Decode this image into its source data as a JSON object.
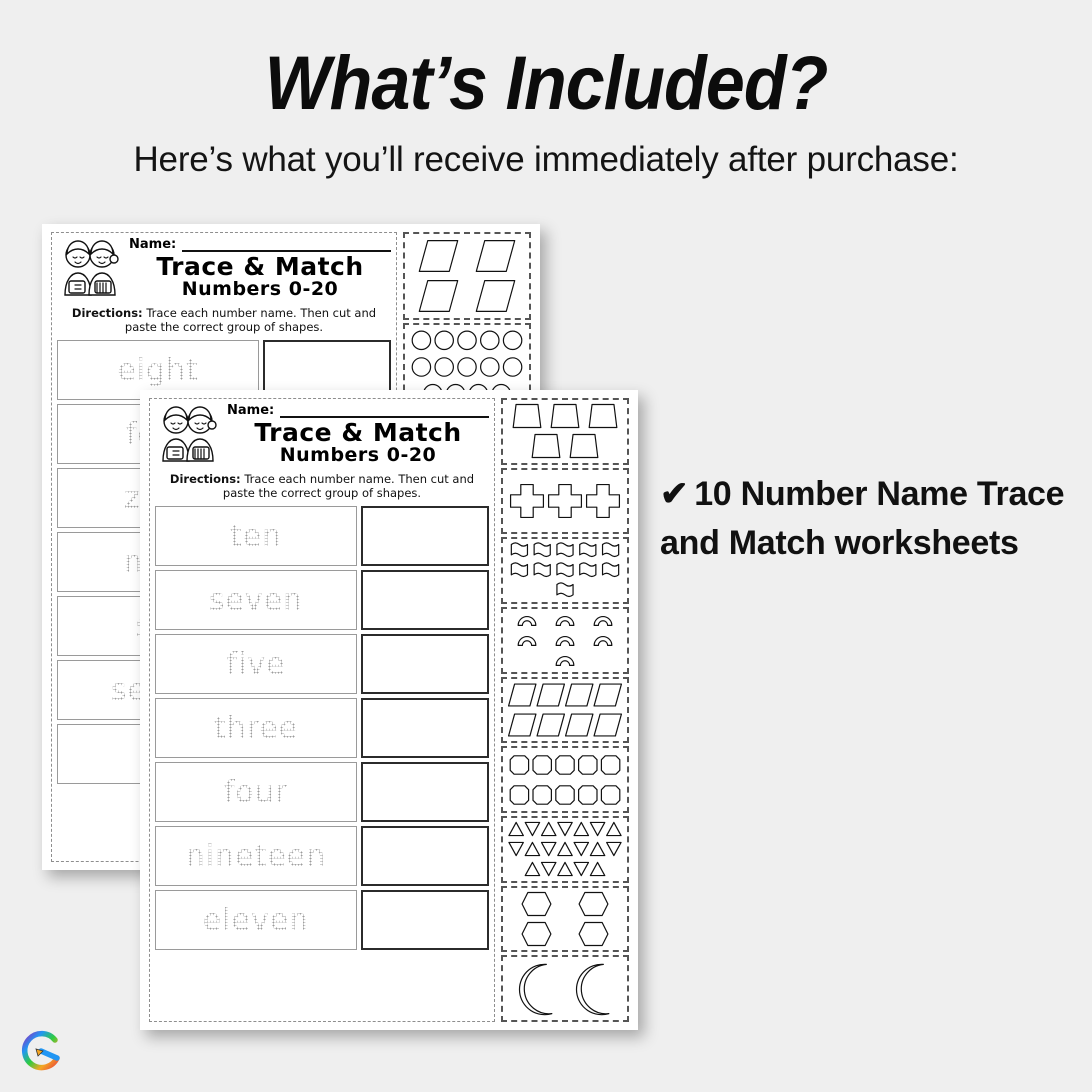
{
  "header": {
    "title": "What’s Included?",
    "subtitle": "Here’s what you’ll receive immediately after purchase:"
  },
  "bullet": {
    "check_icon": "✔",
    "text": "10 Number Name Trace and Match worksheets"
  },
  "colors": {
    "background": "#efefef",
    "text": "#111111",
    "paper": "#ffffff",
    "trace_gray": "#bdbdbd",
    "dash_gray": "#555555"
  },
  "worksheet_back": {
    "name_label": "Name:",
    "title": "Trace & Match",
    "subtitle": "Numbers 0-20",
    "directions_label": "Directions:",
    "directions": "Trace each number name. Then cut and paste the correct group of shapes.",
    "words": [
      "eight",
      "four",
      "zero",
      "nine",
      "six",
      "seven",
      ""
    ],
    "shape_groups": [
      {
        "shape": "parallelogram",
        "count": 4
      },
      {
        "shape": "circle",
        "count": 14
      }
    ]
  },
  "worksheet_front": {
    "name_label": "Name:",
    "title": "Trace & Match",
    "subtitle": "Numbers 0-20",
    "directions_label": "Directions:",
    "directions": "Trace each number name. Then cut and paste the correct group of shapes.",
    "words": [
      "ten",
      "seven",
      "five",
      "three",
      "four",
      "nineteen",
      "eleven"
    ],
    "shape_groups": [
      {
        "shape": "trapezoid",
        "count": 5
      },
      {
        "shape": "cross",
        "count": 3
      },
      {
        "shape": "flag",
        "count": 11
      },
      {
        "shape": "arch",
        "count": 7
      },
      {
        "shape": "parallelogram",
        "count": 8
      },
      {
        "shape": "octagon",
        "count": 10
      },
      {
        "shape": "triangle",
        "count": 19
      },
      {
        "shape": "hexagon",
        "count": 4
      },
      {
        "shape": "crescent",
        "count": 2
      }
    ]
  },
  "logo": {
    "name": "rainbow-pencil-e-logo"
  }
}
